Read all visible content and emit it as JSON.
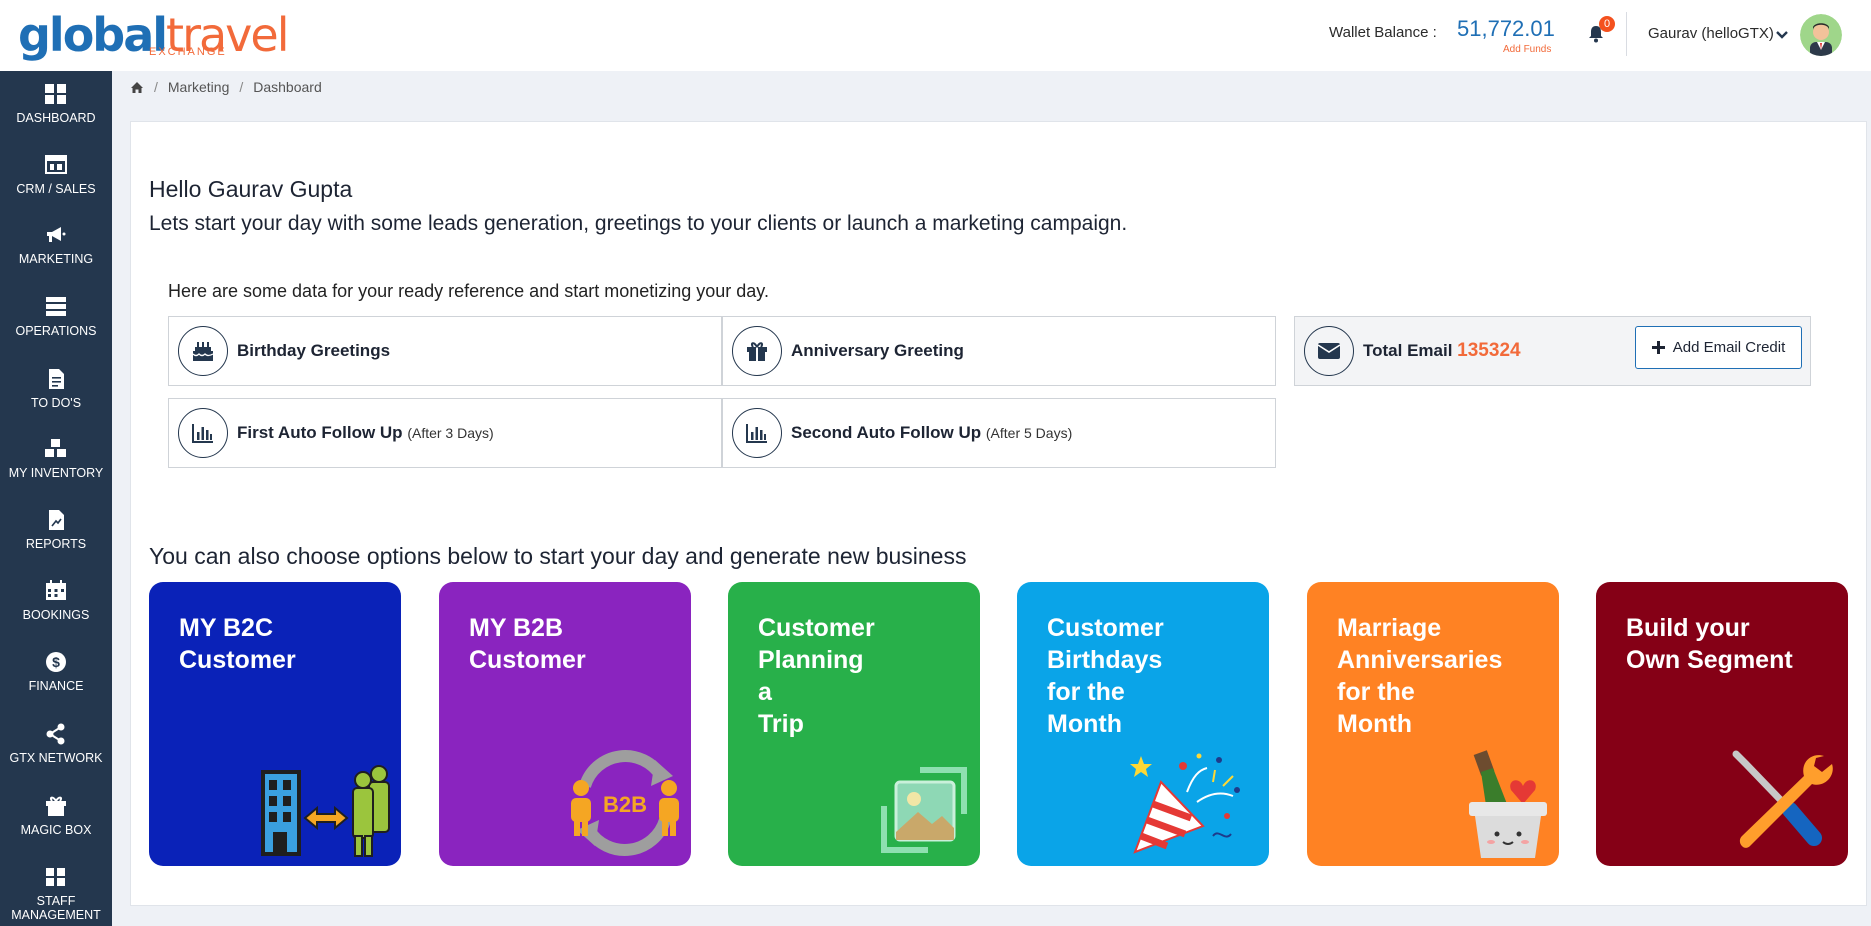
{
  "header": {
    "logo_text_global": "globaltravel",
    "logo_exchange": "EXCHANGE",
    "wallet_label": "Wallet Balance :",
    "wallet_amount": "51,772.01",
    "add_funds": "Add Funds",
    "notification_count": "0",
    "user_name": "Gaurav (helloGTX)"
  },
  "sidebar": {
    "items": [
      {
        "label": "DASHBOARD",
        "icon": "dashboard-icon"
      },
      {
        "label": "CRM / SALES",
        "icon": "crm-icon"
      },
      {
        "label": "MARKETING",
        "icon": "megaphone-icon"
      },
      {
        "label": "OPERATIONS",
        "icon": "operations-icon"
      },
      {
        "label": "TO DO'S",
        "icon": "todo-icon"
      },
      {
        "label": "MY INVENTORY",
        "icon": "inventory-icon"
      },
      {
        "label": "REPORTS",
        "icon": "reports-icon"
      },
      {
        "label": "BOOKINGS",
        "icon": "calendar-icon"
      },
      {
        "label": "FINANCE",
        "icon": "dollar-icon"
      },
      {
        "label": "GTX NETWORK",
        "icon": "share-icon"
      },
      {
        "label": "MAGIC BOX",
        "icon": "magic-box-icon"
      },
      {
        "label": "STAFF",
        "label2": "MANAGEMENT",
        "icon": "staff-icon"
      }
    ]
  },
  "breadcrumb": {
    "items": [
      "Marketing",
      "Dashboard"
    ]
  },
  "main": {
    "hello": "Hello Gaurav Gupta",
    "intro": "Lets start your day with some leads generation, greetings to your clients or launch a marketing campaign.",
    "reference": "Here are some data for your ready reference and start monetizing your day.",
    "tiles": {
      "birthday": "Birthday Greetings",
      "anniversary": "Anniversary Greeting",
      "first_follow": "First Auto Follow Up",
      "first_follow_sub": "(After 3 Days)",
      "second_follow": "Second Auto Follow Up",
      "second_follow_sub": "(After 5 Days)",
      "total_email_label": "Total Email",
      "total_email_value": "135324",
      "add_email_credit": "Add Email Credit"
    },
    "choose_heading": "You can also choose options below to start your day and generate new business",
    "options": [
      {
        "title": "MY B2C\nCustomer",
        "color": "#0a22b8"
      },
      {
        "title": "MY B2B\nCustomer",
        "color": "#8a24bf"
      },
      {
        "title": "Customer\nPlanning\na\nTrip",
        "color": "#28b04a"
      },
      {
        "title": "Customer\nBirthdays\nfor the\nMonth",
        "color": "#0aa4e8"
      },
      {
        "title": "Marriage\nAnniversaries\nfor the\nMonth",
        "color": "#ff8223"
      },
      {
        "title": "Build your\nOwn Segment",
        "color": "#850016"
      }
    ],
    "b2b_badge": "B2B"
  }
}
